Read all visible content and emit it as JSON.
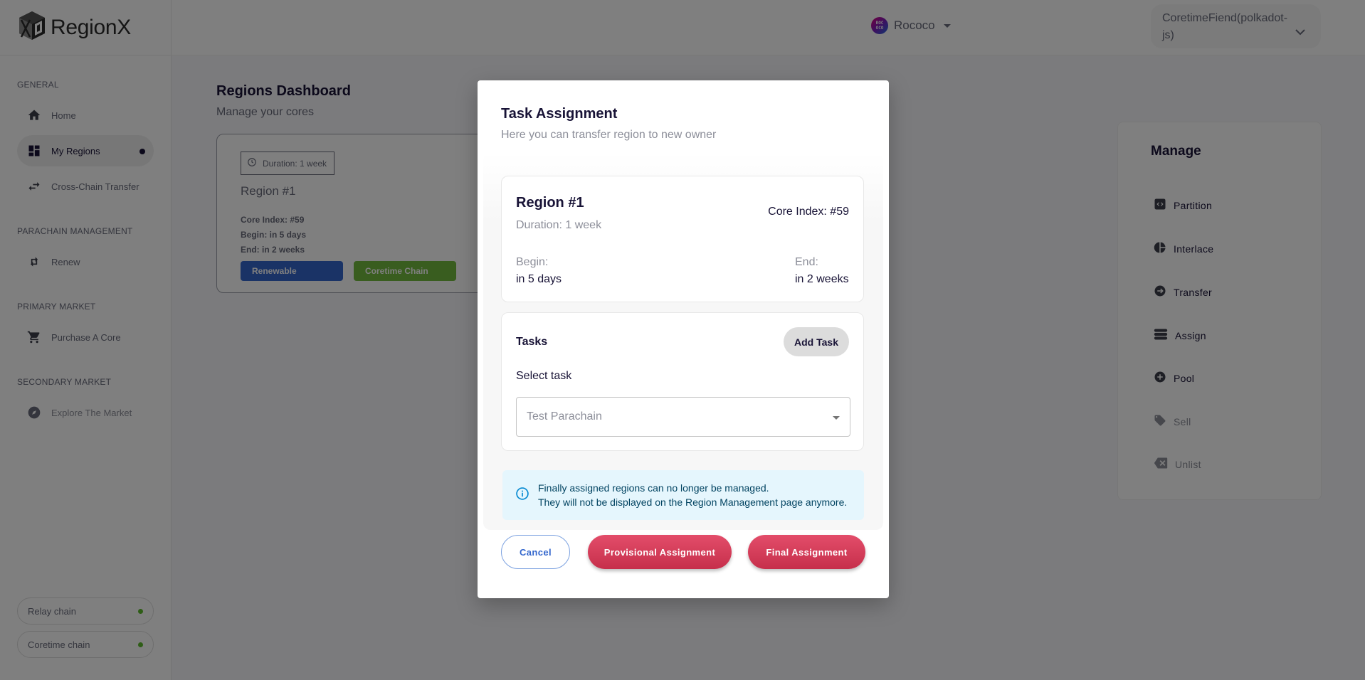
{
  "app": {
    "logo_text": "RegionX",
    "network": {
      "name": "Rococo",
      "logo_text": "ROC\nOCO"
    },
    "account": {
      "label": "CoretimeFiend(polkadot-js)"
    }
  },
  "sidebar": {
    "sections": [
      {
        "heading": "GENERAL",
        "items": [
          {
            "label": "Home",
            "icon": "home-icon",
            "active": false
          },
          {
            "label": "My Regions",
            "icon": "dashboard-icon",
            "active": true
          },
          {
            "label": "Cross-Chain Transfer",
            "icon": "swap-icon",
            "active": false
          }
        ]
      },
      {
        "heading": "PARACHAIN MANAGEMENT",
        "items": [
          {
            "label": "Renew",
            "icon": "renew-icon",
            "active": false
          }
        ]
      },
      {
        "heading": "PRIMARY MARKET",
        "items": [
          {
            "label": "Purchase A Core",
            "icon": "cart-icon",
            "active": false
          }
        ]
      },
      {
        "heading": "SECONDARY MARKET",
        "items": [
          {
            "label": "Explore The Market",
            "icon": "compass-icon",
            "active": false
          }
        ]
      }
    ],
    "chains": [
      {
        "label": "Relay chain",
        "status_color": "#5dbb2d"
      },
      {
        "label": "Coretime chain",
        "status_color": "#5dbb2d"
      }
    ]
  },
  "main": {
    "title": "Regions Dashboard",
    "subtitle": "Manage your cores",
    "region_card": {
      "duration": "Duration: 1 week",
      "name": "Region #1",
      "core_index": "Core Index: #59",
      "begin": "Begin: in 5 days",
      "end": "End: in 2 weeks",
      "tags": [
        "Renewable",
        "Coretime Chain"
      ]
    },
    "manage": {
      "title": "Manage",
      "items": [
        {
          "label": "Partition",
          "icon": "partition-icon",
          "enabled": true
        },
        {
          "label": "Interlace",
          "icon": "pie-icon",
          "enabled": true
        },
        {
          "label": "Transfer",
          "icon": "arrow-right-circle-icon",
          "enabled": true
        },
        {
          "label": "Assign",
          "icon": "storage-icon",
          "enabled": true
        },
        {
          "label": "Pool",
          "icon": "plus-circle-icon",
          "enabled": true
        },
        {
          "label": "Sell",
          "icon": "tag-icon",
          "enabled": false
        },
        {
          "label": "Unlist",
          "icon": "backspace-icon",
          "enabled": false
        }
      ]
    }
  },
  "modal": {
    "title": "Task Assignment",
    "subtitle": "Here you can transfer region to new owner",
    "region": {
      "name": "Region #1",
      "duration": "Duration: 1 week",
      "core_index": "Core Index: #59",
      "begin_label": "Begin:",
      "begin_value": "in 5 days",
      "end_label": "End:",
      "end_value": "in 2 weeks"
    },
    "tasks": {
      "title": "Tasks",
      "add_task_label": "Add Task",
      "select_label": "Select task",
      "selected_value": "Test Parachain"
    },
    "alert": {
      "line1": "Finally assigned regions can no longer be managed.",
      "line2": "They will not be displayed on the Region Management page anymore."
    },
    "buttons": {
      "cancel": "Cancel",
      "provisional": "Provisional Assignment",
      "final": "Final Assignment"
    }
  }
}
